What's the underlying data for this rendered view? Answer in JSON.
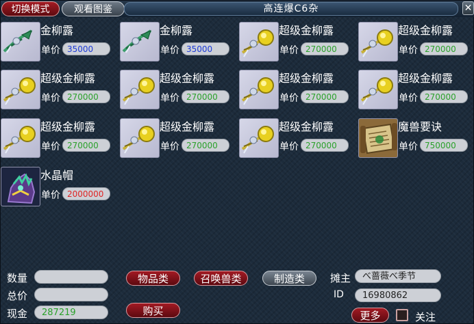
{
  "window": {
    "title": "高连爆C6杂",
    "switch_mode_label": "切换模式",
    "view_catalog_label": "观看图鉴",
    "close_symbol": "✕"
  },
  "items": [
    {
      "name": "金柳露",
      "price_label": "单价",
      "price": "35000",
      "price_color": "blue",
      "icon": "jinliulu-icon"
    },
    {
      "name": "金柳露",
      "price_label": "单价",
      "price": "35000",
      "price_color": "blue",
      "icon": "jinliulu-icon"
    },
    {
      "name": "超级金柳露",
      "price_label": "单价",
      "price": "270000",
      "price_color": "green",
      "icon": "chaoji-jinliulu-icon"
    },
    {
      "name": "超级金柳露",
      "price_label": "单价",
      "price": "270000",
      "price_color": "green",
      "icon": "chaoji-jinliulu-icon"
    },
    {
      "name": "超级金柳露",
      "price_label": "单价",
      "price": "270000",
      "price_color": "green",
      "icon": "chaoji-jinliulu-icon"
    },
    {
      "name": "超级金柳露",
      "price_label": "单价",
      "price": "270000",
      "price_color": "green",
      "icon": "chaoji-jinliulu-icon"
    },
    {
      "name": "超级金柳露",
      "price_label": "单价",
      "price": "270000",
      "price_color": "green",
      "icon": "chaoji-jinliulu-icon"
    },
    {
      "name": "超级金柳露",
      "price_label": "单价",
      "price": "270000",
      "price_color": "green",
      "icon": "chaoji-jinliulu-icon"
    },
    {
      "name": "超级金柳露",
      "price_label": "单价",
      "price": "270000",
      "price_color": "green",
      "icon": "chaoji-jinliulu-icon"
    },
    {
      "name": "超级金柳露",
      "price_label": "单价",
      "price": "270000",
      "price_color": "green",
      "icon": "chaoji-jinliulu-icon"
    },
    {
      "name": "超级金柳露",
      "price_label": "单价",
      "price": "270000",
      "price_color": "green",
      "icon": "chaoji-jinliulu-icon"
    },
    {
      "name": "魔兽要诀",
      "price_label": "单价",
      "price": "750000",
      "price_color": "green",
      "icon": "scroll-icon"
    },
    {
      "name": "水晶帽",
      "price_label": "单价",
      "price": "2000000",
      "price_color": "red",
      "icon": "crystal-hat-icon"
    }
  ],
  "bottom": {
    "quantity_label": "数量",
    "quantity_value": "",
    "total_label": "总价",
    "total_value": "",
    "cash_label": "现金",
    "cash_value": "287219",
    "tab_items": "物品类",
    "tab_summon": "召唤兽类",
    "tab_crafting": "制造类",
    "buy_label": "购买",
    "owner_label": "摊主",
    "owner_value": "べ蔷薇べ季节",
    "id_label": "ID",
    "id_value": "16980862",
    "more_label": "更多",
    "follow_label": "关注"
  },
  "colors": {
    "blue": "#1c3ad6",
    "green": "#2aa12a",
    "red": "#e02424"
  }
}
